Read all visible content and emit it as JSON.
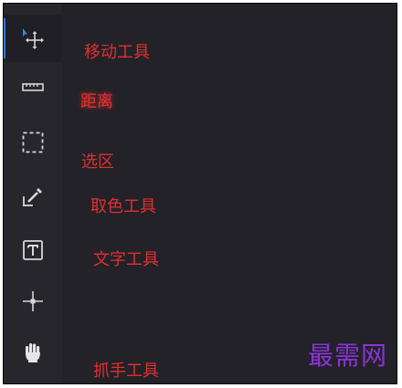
{
  "toolbar": {
    "tools": [
      {
        "id": "move",
        "icon": "move-icon",
        "active": true
      },
      {
        "id": "distance",
        "icon": "ruler-icon",
        "active": false
      },
      {
        "id": "selection",
        "icon": "dashed-rect-icon",
        "active": false
      },
      {
        "id": "color-picker",
        "icon": "eyedropper-icon",
        "active": false
      },
      {
        "id": "text",
        "icon": "text-box-icon",
        "active": false
      },
      {
        "id": "crosshair",
        "icon": "crosshair-icon",
        "active": false
      },
      {
        "id": "hand",
        "icon": "hand-icon",
        "active": false
      }
    ]
  },
  "annotations": {
    "move": "移动工具",
    "distance": "距离",
    "selection": "选区",
    "color_picker": "取色工具",
    "text": "文字工具",
    "hand": "抓手工具"
  },
  "watermark": "最需网",
  "colors": {
    "panel_bg": "#222228",
    "toolbar_bg": "#26262c",
    "icon": "#d8d8d8",
    "active_accent": "#2f7bd9",
    "annotation": "#e03030",
    "watermark": "#8b33d6"
  }
}
